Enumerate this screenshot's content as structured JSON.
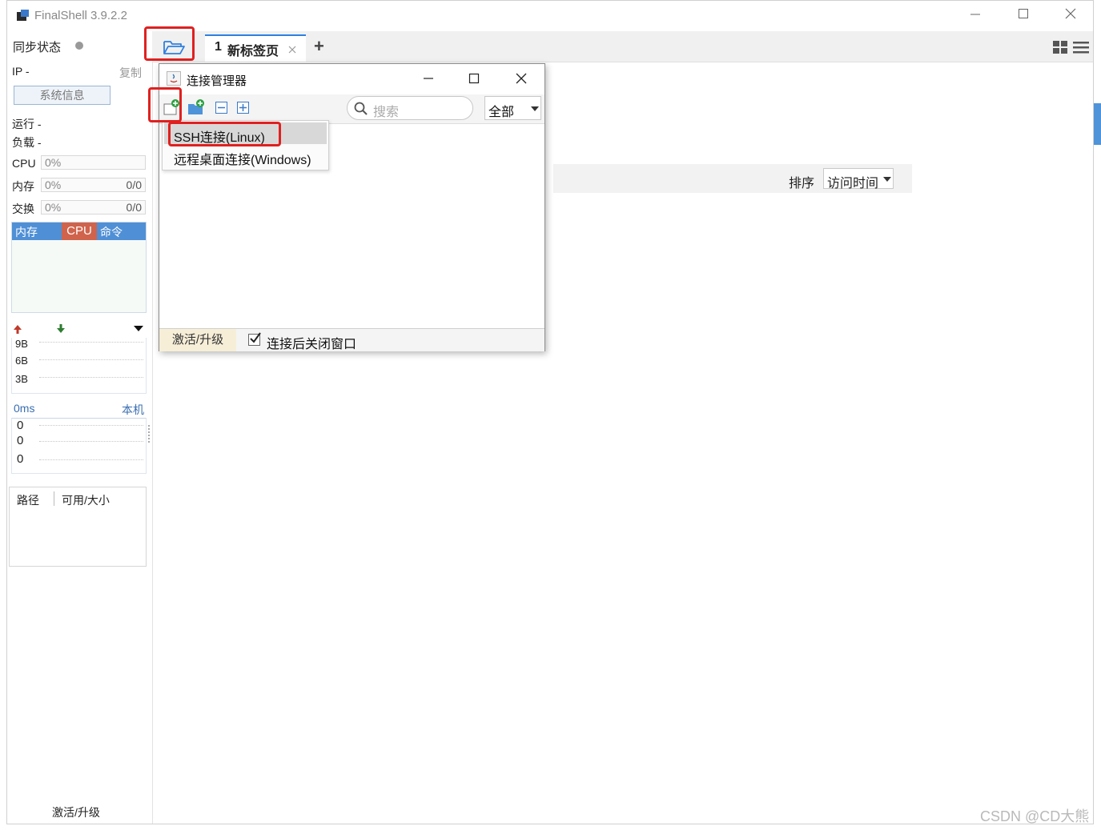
{
  "window": {
    "title": "FinalShell 3.9.2.2"
  },
  "left_panel": {
    "sync_status_label": "同步状态",
    "ip_label": "IP  -",
    "copy_label": "复制",
    "sysinfo_button": "系统信息",
    "run_label": "运行 -",
    "load_label": "负载 -",
    "meters": [
      {
        "label": "CPU",
        "percent": "0%",
        "extra": ""
      },
      {
        "label": "内存",
        "percent": "0%",
        "extra": "0/0"
      },
      {
        "label": "交换",
        "percent": "0%",
        "extra": "0/0"
      }
    ],
    "proc_tabs": [
      "内存",
      "CPU",
      "命令"
    ],
    "net_ticks": [
      "9B",
      "6B",
      "3B"
    ],
    "ping": {
      "latency": "0ms",
      "host": "本机",
      "values": [
        "0",
        "0",
        "0"
      ]
    },
    "disk_columns": [
      "路径",
      "可用/大小"
    ],
    "activate_label": "激活/升级"
  },
  "tabbar": {
    "tab": {
      "index": "1",
      "label": "新标签页"
    },
    "add_label": "+"
  },
  "main": {
    "sort_label": "排序",
    "sort_value": "访问时间"
  },
  "dialog": {
    "title": "连接管理器",
    "search_placeholder": "搜索",
    "filter_value": "全部",
    "menu_items": [
      "SSH连接(Linux)",
      "远程桌面连接(Windows)"
    ],
    "footer_activate": "激活/升级",
    "close_after_connect_label": "连接后关闭窗口",
    "close_after_connect_checked": true
  },
  "watermark": "CSDN @CD大熊",
  "colors": {
    "accent_blue": "#2f7fe0",
    "tab_memory_blue": "#4f8fd6",
    "tab_cpu_red": "#d0634c",
    "highlight_red": "#e02020"
  }
}
